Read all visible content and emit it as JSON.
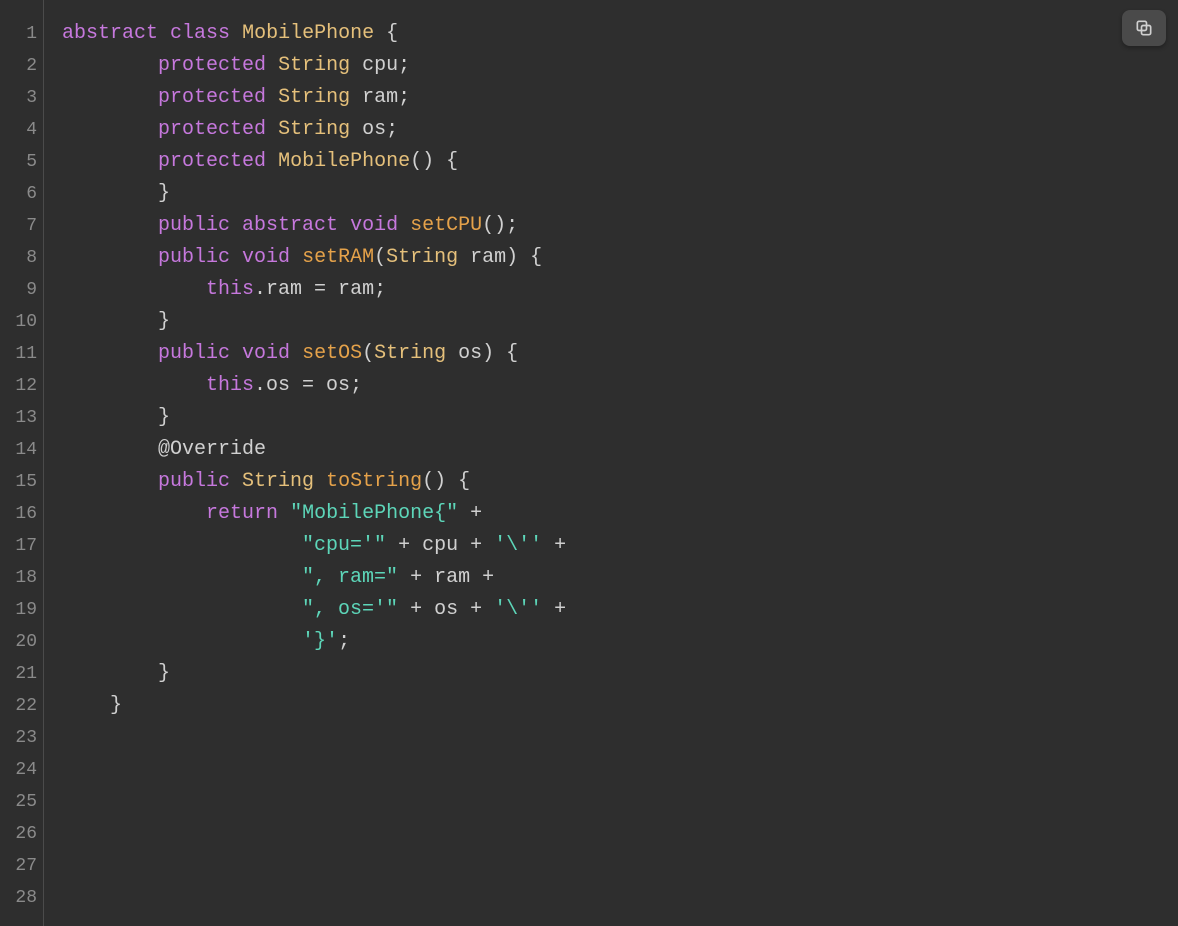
{
  "copy_tooltip": "Copy",
  "line_count": 28,
  "code_lines": [
    {
      "indent": 0,
      "tokens": [
        {
          "t": "abstract",
          "c": "kw-mod"
        },
        {
          "t": " "
        },
        {
          "t": "class",
          "c": "kw-mod"
        },
        {
          "t": " "
        },
        {
          "t": "MobilePhone",
          "c": "kw-type"
        },
        {
          "t": " "
        },
        {
          "t": "{",
          "c": "punc"
        }
      ]
    },
    {
      "indent": 2,
      "tokens": [
        {
          "t": "protected",
          "c": "kw-mod"
        },
        {
          "t": " "
        },
        {
          "t": "String",
          "c": "kw-type"
        },
        {
          "t": " cpu;",
          "c": "punc"
        }
      ]
    },
    {
      "indent": 2,
      "tokens": [
        {
          "t": "protected",
          "c": "kw-mod"
        },
        {
          "t": " "
        },
        {
          "t": "String",
          "c": "kw-type"
        },
        {
          "t": " ram;",
          "c": "punc"
        }
      ]
    },
    {
      "indent": 2,
      "tokens": [
        {
          "t": "protected",
          "c": "kw-mod"
        },
        {
          "t": " "
        },
        {
          "t": "String",
          "c": "kw-type"
        },
        {
          "t": " os;",
          "c": "punc"
        }
      ]
    },
    {
      "indent": 0,
      "tokens": []
    },
    {
      "indent": 2,
      "tokens": [
        {
          "t": "protected",
          "c": "kw-mod"
        },
        {
          "t": " "
        },
        {
          "t": "MobilePhone",
          "c": "kw-type"
        },
        {
          "t": "() {",
          "c": "punc"
        }
      ]
    },
    {
      "indent": 0,
      "tokens": []
    },
    {
      "indent": 2,
      "tokens": [
        {
          "t": "}",
          "c": "punc"
        }
      ]
    },
    {
      "indent": 0,
      "tokens": []
    },
    {
      "indent": 2,
      "tokens": [
        {
          "t": "public",
          "c": "kw-mod"
        },
        {
          "t": " "
        },
        {
          "t": "abstract",
          "c": "kw-mod"
        },
        {
          "t": " "
        },
        {
          "t": "void",
          "c": "kw-mod"
        },
        {
          "t": " "
        },
        {
          "t": "setCPU",
          "c": "fn"
        },
        {
          "t": "();",
          "c": "punc"
        }
      ]
    },
    {
      "indent": 0,
      "tokens": []
    },
    {
      "indent": 2,
      "tokens": [
        {
          "t": "public",
          "c": "kw-mod"
        },
        {
          "t": " "
        },
        {
          "t": "void",
          "c": "kw-mod"
        },
        {
          "t": " "
        },
        {
          "t": "setRAM",
          "c": "fn"
        },
        {
          "t": "(",
          "c": "punc"
        },
        {
          "t": "String",
          "c": "kw-type"
        },
        {
          "t": " ram) {",
          "c": "punc"
        }
      ]
    },
    {
      "indent": 3,
      "tokens": [
        {
          "t": "this",
          "c": "kw-mod"
        },
        {
          "t": ".ram = ram;",
          "c": "punc"
        }
      ]
    },
    {
      "indent": 2,
      "tokens": [
        {
          "t": "}",
          "c": "punc"
        }
      ]
    },
    {
      "indent": 0,
      "tokens": []
    },
    {
      "indent": 2,
      "tokens": [
        {
          "t": "public",
          "c": "kw-mod"
        },
        {
          "t": " "
        },
        {
          "t": "void",
          "c": "kw-mod"
        },
        {
          "t": " "
        },
        {
          "t": "setOS",
          "c": "fn"
        },
        {
          "t": "(",
          "c": "punc"
        },
        {
          "t": "String",
          "c": "kw-type"
        },
        {
          "t": " os) {",
          "c": "punc"
        }
      ]
    },
    {
      "indent": 3,
      "tokens": [
        {
          "t": "this",
          "c": "kw-mod"
        },
        {
          "t": ".os = os;",
          "c": "punc"
        }
      ]
    },
    {
      "indent": 2,
      "tokens": [
        {
          "t": "}",
          "c": "punc"
        }
      ]
    },
    {
      "indent": 0,
      "tokens": []
    },
    {
      "indent": 2,
      "tokens": [
        {
          "t": "@Override",
          "c": "anno"
        }
      ]
    },
    {
      "indent": 2,
      "tokens": [
        {
          "t": "public",
          "c": "kw-mod"
        },
        {
          "t": " "
        },
        {
          "t": "String",
          "c": "kw-type"
        },
        {
          "t": " "
        },
        {
          "t": "toString",
          "c": "fn"
        },
        {
          "t": "() {",
          "c": "punc"
        }
      ]
    },
    {
      "indent": 3,
      "tokens": [
        {
          "t": "return",
          "c": "kw-mod"
        },
        {
          "t": " "
        },
        {
          "t": "\"MobilePhone{\"",
          "c": "str"
        },
        {
          "t": " + ",
          "c": "op"
        }
      ]
    },
    {
      "indent": 5,
      "tokens": [
        {
          "t": "\"cpu='\"",
          "c": "str"
        },
        {
          "t": " + cpu + ",
          "c": "op"
        },
        {
          "t": "'\\''",
          "c": "char"
        },
        {
          "t": " +",
          "c": "op"
        }
      ]
    },
    {
      "indent": 5,
      "tokens": [
        {
          "t": "\", ram=\"",
          "c": "str"
        },
        {
          "t": " + ram +",
          "c": "op"
        }
      ]
    },
    {
      "indent": 5,
      "tokens": [
        {
          "t": "\", os='\"",
          "c": "str"
        },
        {
          "t": " + os + ",
          "c": "op"
        },
        {
          "t": "'\\''",
          "c": "char"
        },
        {
          "t": " +",
          "c": "op"
        }
      ]
    },
    {
      "indent": 5,
      "tokens": [
        {
          "t": "'}'",
          "c": "char"
        },
        {
          "t": ";",
          "c": "punc"
        }
      ]
    },
    {
      "indent": 2,
      "tokens": [
        {
          "t": "}",
          "c": "punc"
        }
      ]
    },
    {
      "indent": 1,
      "tokens": [
        {
          "t": "}",
          "c": "punc"
        }
      ]
    }
  ]
}
